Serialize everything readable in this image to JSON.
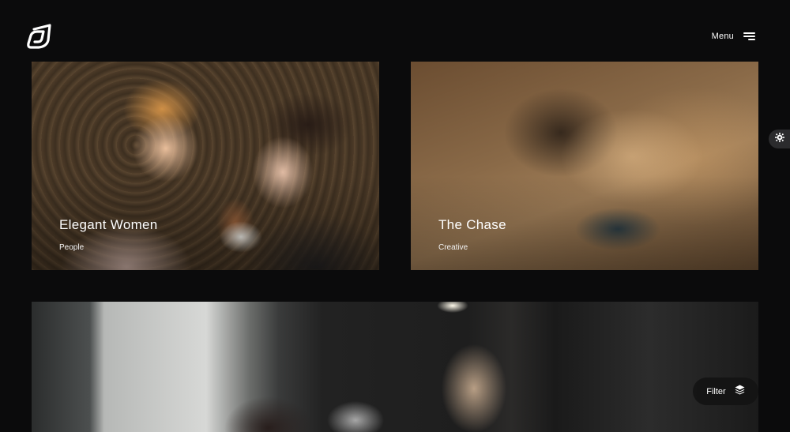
{
  "header": {
    "menu_label": "Menu"
  },
  "projects": [
    {
      "title": "Elegant Women",
      "category": "People"
    },
    {
      "title": "The Chase",
      "category": "Creative"
    },
    {
      "title": "",
      "category": ""
    }
  ],
  "filter": {
    "label": "Filter"
  },
  "icons": {
    "logo": "brand-logo-icon",
    "menu": "hamburger-icon",
    "settings": "gear-icon",
    "filter": "layers-icon"
  },
  "colors": {
    "background": "#0b0b0c",
    "text": "#ffffff",
    "filter_bg": "#141414",
    "side_toggle_bg": "#2b2b2d"
  }
}
